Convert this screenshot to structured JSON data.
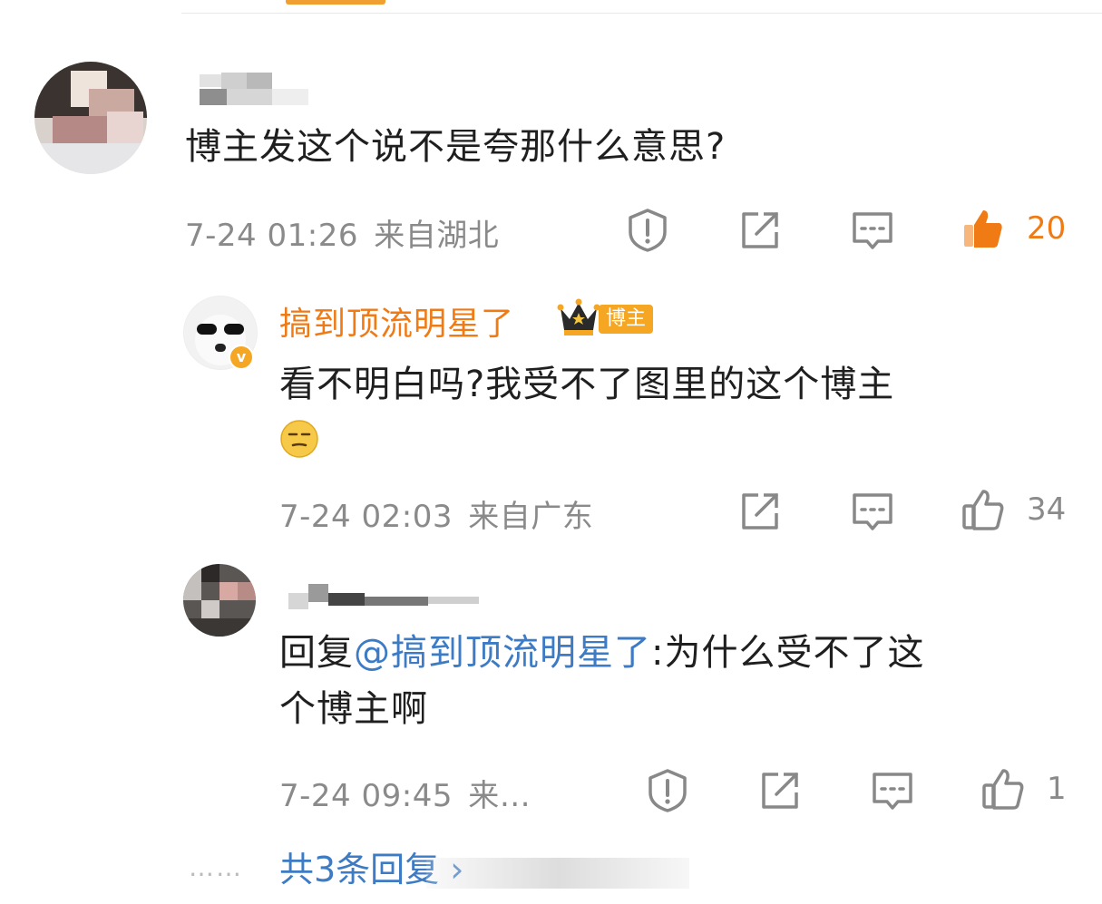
{
  "comment1": {
    "text": "博主发这个说不是夸那什么意思?",
    "time": "7-24 01:26",
    "location": "来自湖北",
    "likes": "20",
    "liked": true
  },
  "reply1": {
    "author": "搞到顶流明星了",
    "badge": "博主",
    "text": "看不明白吗?我受不了图里的这个博主",
    "time": "7-24 02:03",
    "location": "来自广东",
    "likes": "34"
  },
  "reply2": {
    "prefix": "回复",
    "mention": "@搞到顶流明星了",
    "text": ":为什么受不了这",
    "text2": "个博主啊",
    "time": "7-24 09:45",
    "location": "来…",
    "likes": "1"
  },
  "footer": {
    "dots": "……",
    "more_replies": "共3条回复 ›"
  },
  "icons": {
    "report": "report-icon",
    "share": "share-icon",
    "comment": "comment-icon",
    "like": "thumbs-up-icon",
    "crown": "crown-icon",
    "verified": "verified-v-icon",
    "emoji": "smirk-emoji-icon"
  },
  "colors": {
    "accent": "#f07a14",
    "link": "#3d7bc4",
    "meta": "#8a8a8a"
  }
}
